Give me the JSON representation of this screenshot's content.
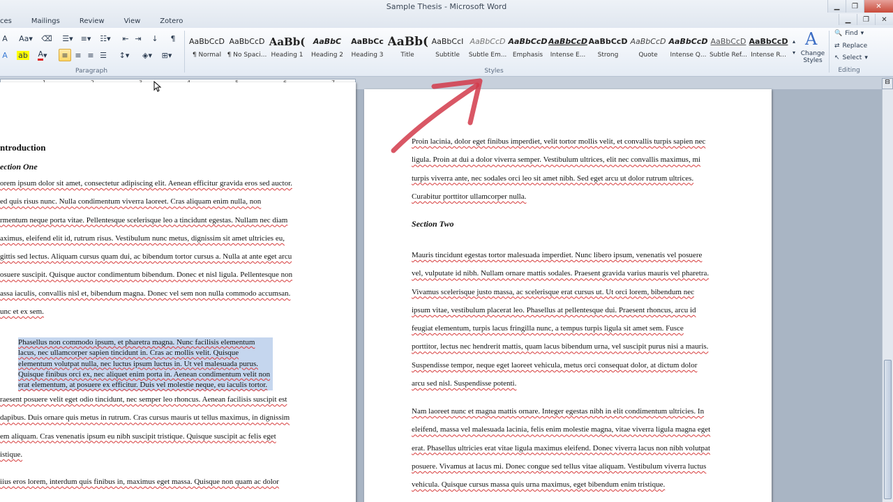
{
  "window": {
    "title": "Sample Thesis - Microsoft Word"
  },
  "tabs": [
    "ces",
    "Mailings",
    "Review",
    "View",
    "Zotero"
  ],
  "ribbon": {
    "paragraph_label": "Paragraph",
    "styles_label": "Styles",
    "editing_label": "Editing",
    "styles": [
      {
        "sample": "AaBbCcD",
        "name": "¶ Normal",
        "kind": "normal"
      },
      {
        "sample": "AaBbCcD",
        "name": "¶ No Spaci...",
        "kind": "normal"
      },
      {
        "sample": "AaBb(",
        "name": "Heading 1",
        "kind": "big"
      },
      {
        "sample": "AaBbC",
        "name": "Heading 2",
        "kind": "boldi"
      },
      {
        "sample": "AaBbCc",
        "name": "Heading 3",
        "kind": "strong"
      },
      {
        "sample": "AaBb(",
        "name": "Title",
        "kind": "title"
      },
      {
        "sample": "AaBbCcI",
        "name": "Subtitle",
        "kind": "normal"
      },
      {
        "sample": "AaBbCcD",
        "name": "Subtle Em...",
        "kind": "subtle"
      },
      {
        "sample": "AaBbCcD",
        "name": "Emphasis",
        "kind": "boldi"
      },
      {
        "sample": "AaBbCcD",
        "name": "Intense E...",
        "kind": "intense"
      },
      {
        "sample": "AaBbCcD",
        "name": "Strong",
        "kind": "strong"
      },
      {
        "sample": "AaBbCcD",
        "name": "Quote",
        "kind": "quote"
      },
      {
        "sample": "AaBbCcD",
        "name": "Intense Q...",
        "kind": "boldi"
      },
      {
        "sample": "AaBbCcD",
        "name": "Subtle Ref...",
        "kind": "subtleref"
      },
      {
        "sample": "AaBbCcD",
        "name": "Intense R...",
        "kind": "intenseref"
      }
    ],
    "change_styles_label": "Change Styles",
    "find_label": "Find",
    "replace_label": "Replace",
    "select_label": "Select"
  },
  "ruler": {
    "numbers": [
      "1",
      "2",
      "3",
      "4",
      "5",
      "6",
      "7"
    ]
  },
  "left_page": {
    "heading": "ntroduction",
    "subheading": "ection One",
    "para1": [
      "orem ipsum dolor sit amet, consectetur adipiscing elit. Aenean efficitur gravida eros sed auctor.",
      "ed quis risus nunc. Nulla condimentum viverra laoreet. Cras aliquam enim nulla, non",
      "rmentum neque porta vitae. Pellentesque scelerisque leo a tincidunt egestas. Nullam nec diam",
      "aximus, eleifend elit id, rutrum risus. Vestibulum nunc metus, dignissim sit amet ultricies eu,",
      "gittis sed lectus. Aliquam cursus quam dui, ac bibendum tortor cursus a. Nulla at ante eget arcu",
      "osuere suscipit. Quisque auctor condimentum bibendum. Donec et nisl ligula. Pellentesque non",
      "assa iaculis, convallis nisl et, bibendum magna. Donec vel sem non nulla commodo accumsan.",
      "unc et ex sem."
    ],
    "quote": [
      "Phasellus non commodo ipsum, et pharetra magna. Nunc facilisis elementum",
      "lacus, nec ullamcorper sapien tincidunt in. Cras ac mollis velit. Quisque",
      "elementum volutpat nulla, nec luctus ipsum luctus in. Ut vel malesuada purus.",
      "Quisque finibus orci ex, nec aliquet enim porta in. Aenean condimentum velit non",
      "erat elementum, at posuere ex efficitur. Duis vel molestie neque, eu iaculis tortor."
    ],
    "para2": [
      "raesent posuere velit eget odio tincidunt, nec semper leo rhoncus. Aenean facilisis suscipit est",
      "dapibus. Duis ornare quis metus in rutrum. Cras cursus mauris ut tellus maximus, in dignissim",
      "em aliquam. Cras venenatis ipsum eu nibh suscipit tristique. Quisque suscipit ac felis eget",
      "istique."
    ],
    "para3": [
      "iius eros lorem, interdum quis finibus in, maximus eget massa. Quisque non quam ac dolor"
    ]
  },
  "right_page": {
    "para1": [
      "Proin lacinia, dolor eget finibus imperdiet, velit tortor mollis velit, et convallis turpis sapien nec",
      "ligula. Proin at dui a dolor viverra semper. Vestibulum ultrices, elit nec convallis maximus, mi",
      "turpis viverra ante, nec sodales orci leo sit amet nibh. Sed eget arcu ut dolor rutrum ultrices.",
      "Curabitur porttitor ullamcorper nulla."
    ],
    "subheading": "Section Two",
    "para2": [
      "Mauris tincidunt egestas tortor malesuada imperdiet. Nunc libero ipsum, venenatis vel posuere",
      "vel, vulputate id nibh. Nullam ornare mattis sodales. Praesent gravida varius mauris vel pharetra.",
      "Vivamus scelerisque justo massa, ac scelerisque erat cursus ut. Ut orci lorem, bibendum nec",
      "ipsum vitae, vestibulum placerat leo. Phasellus at pellentesque dui. Praesent rhoncus, arcu id",
      "feugiat elementum, turpis lacus fringilla nunc, a tempus turpis ligula sit amet sem. Fusce",
      "porttitor, lectus nec hendrerit mattis, quam lacus bibendum urna, vel suscipit purus nisi a mauris.",
      "Suspendisse tempor, neque eget laoreet vehicula, metus orci consequat dolor, at dictum dolor",
      "arcu sed nisl. Suspendisse potenti."
    ],
    "para3": [
      "Nam laoreet nunc et magna mattis ornare. Integer egestas nibh in elit condimentum ultricies. In",
      "eleifend, massa vel malesuada lacinia, felis enim molestie magna, vitae viverra ligula magna eget",
      "erat. Phasellus ultricies erat vitae ligula maximus eleifend. Donec viverra lacus non nibh volutpat",
      "posuere. Vivamus at lacus mi. Donec congue sed tellus vitae aliquam. Vestibulum viverra luctus",
      "vehicula. Quisque cursus massa quis urna maximus, eget bibendum enim tristique."
    ]
  },
  "colors": {
    "annotation_arrow": "#d23a4a",
    "selection": "#c5d6ee",
    "spell_underline": "#d63a3a"
  }
}
